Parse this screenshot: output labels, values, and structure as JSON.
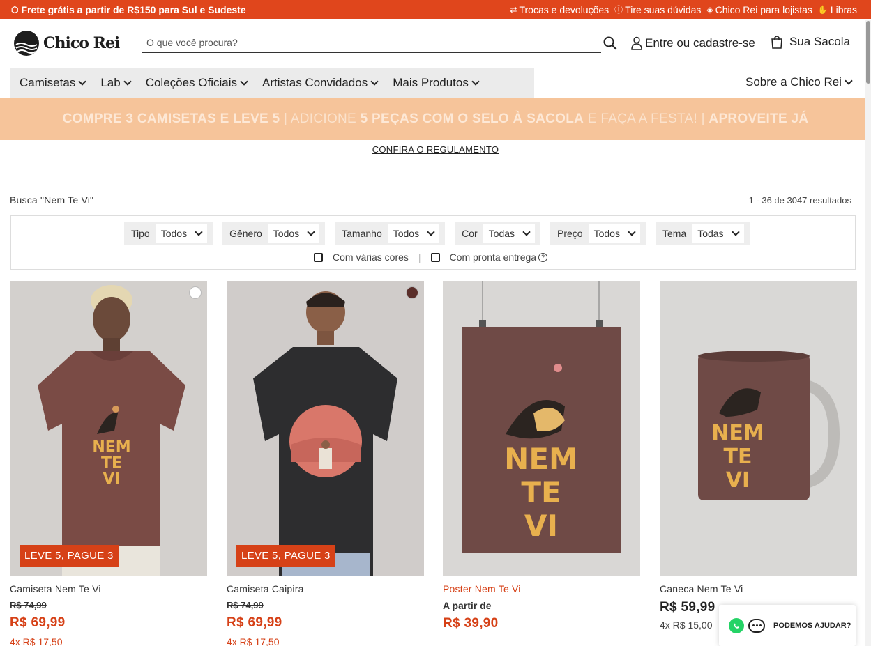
{
  "topbar": {
    "shipping": "Frete grátis a partir de R$150 para Sul e Sudeste",
    "links": [
      "Trocas e devoluções",
      "Tire suas dúvidas",
      "Chico Rei para lojistas",
      "Libras"
    ]
  },
  "header": {
    "logo": "Chico Rei",
    "search_placeholder": "O que você procura?",
    "account": "Entre ou cadastre-se",
    "bag": "Sua Sacola"
  },
  "nav": {
    "items": [
      "Camisetas",
      "Lab",
      "Coleções Oficiais",
      "Artistas Convidados",
      "Mais Produtos"
    ],
    "about": "Sobre a Chico Rei"
  },
  "promo": {
    "part1": "COMPRE 3 CAMISETAS E LEVE 5",
    "sep1": " | ADICIONE ",
    "part2": "5 PEÇAS COM O SELO À SACOLA",
    "part3": " E FAÇA A FESTA! | ",
    "part4": "APROVEITE JÁ",
    "rules": "CONFIRA O REGULAMENTO"
  },
  "results": {
    "label": "Busca \"Nem Te Vi\"",
    "count": "1 - 36 de 3047 resultados"
  },
  "filters": {
    "items": [
      {
        "label": "Tipo",
        "value": "Todos"
      },
      {
        "label": "Gênero",
        "value": "Todos"
      },
      {
        "label": "Tamanho",
        "value": "Todos"
      },
      {
        "label": "Cor",
        "value": "Todas"
      },
      {
        "label": "Preço",
        "value": "Todos"
      },
      {
        "label": "Tema",
        "value": "Todas"
      }
    ],
    "multi_color": "Com várias cores",
    "ready": "Com pronta entrega"
  },
  "products": [
    {
      "name": "Camiseta Nem Te Vi",
      "badge": "LEVE 5, PAGUE 3",
      "old_price": "R$ 74,99",
      "price": "R$ 69,99",
      "installment": "4x R$ 17,50"
    },
    {
      "name": "Camiseta Caipira",
      "badge": "LEVE 5, PAGUE 3",
      "old_price": "R$ 74,99",
      "price": "R$ 69,99",
      "installment": "4x R$ 17,50"
    },
    {
      "name": "Poster Nem Te Vi",
      "from": "A partir de",
      "price": "R$ 39,90"
    },
    {
      "name": "Caneca Nem Te Vi",
      "price": "R$ 59,99",
      "installment": "4x R$ 15,00"
    }
  ],
  "chat": {
    "label": "PODEMOS AJUDAR?"
  },
  "colors": {
    "brand": "#e0461c",
    "price": "#d64117",
    "promo_bg": "#f6c49a"
  },
  "illustration": {
    "text_lines": [
      "NEM",
      "TE",
      "VI"
    ]
  }
}
